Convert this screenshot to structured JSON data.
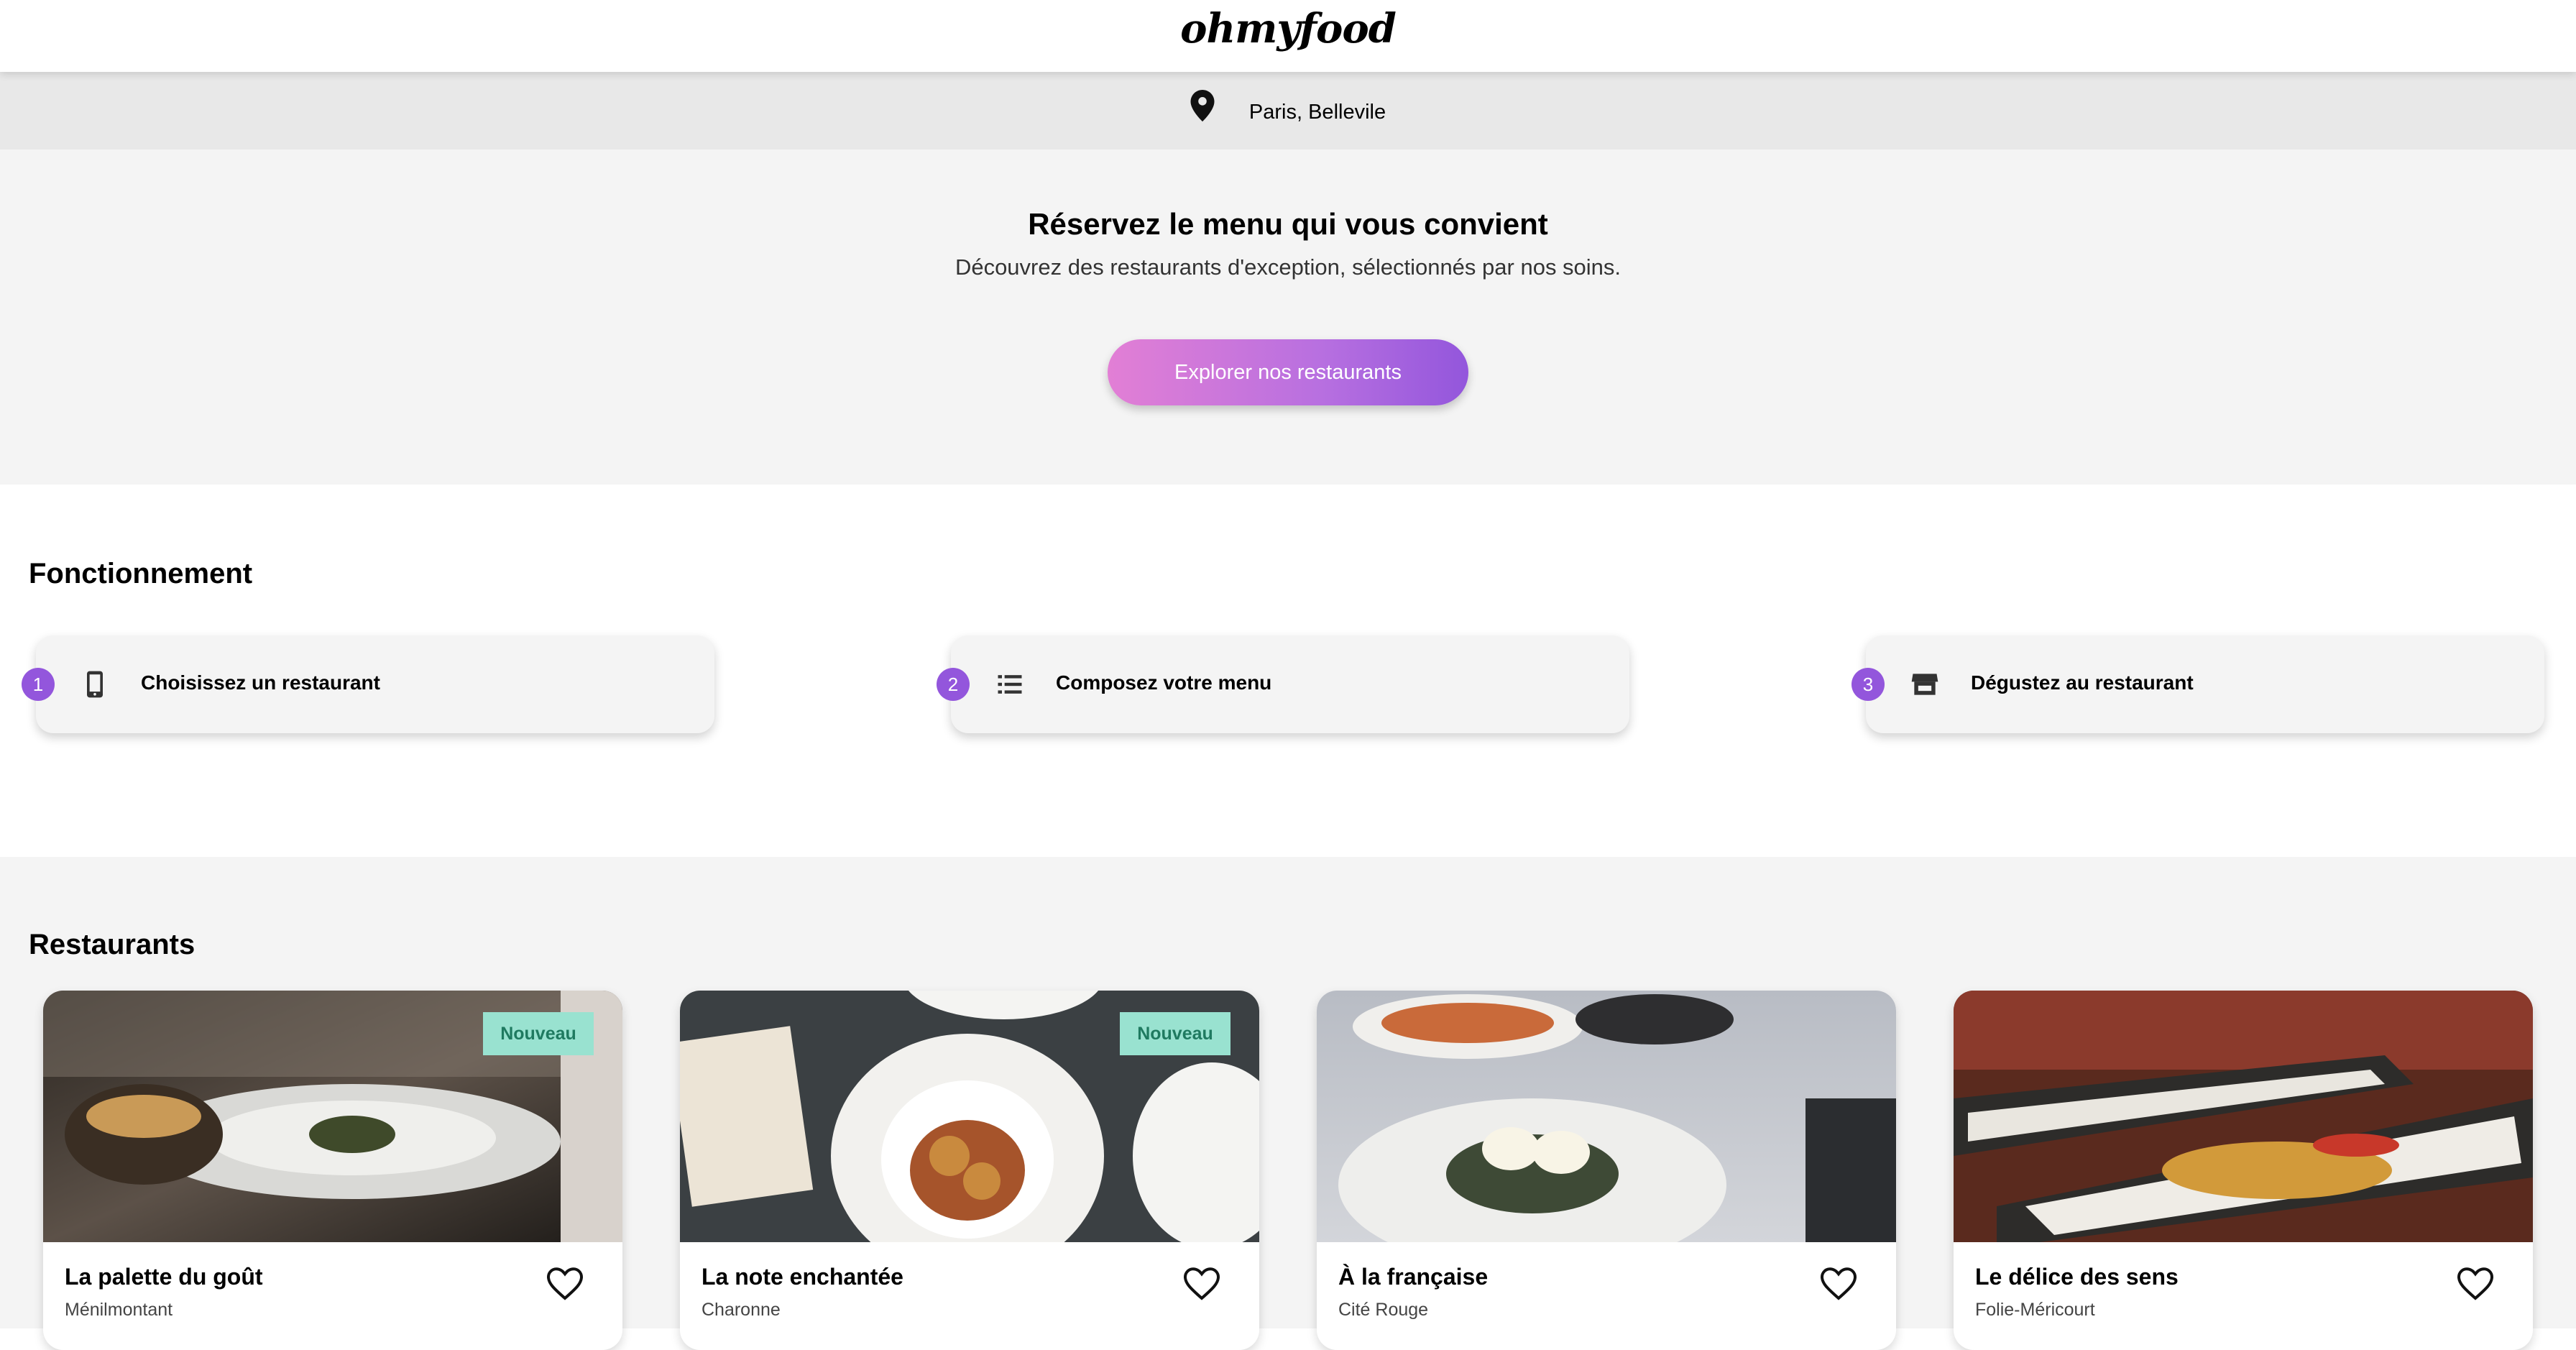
{
  "header": {
    "logo": "ohmyfood"
  },
  "location": {
    "icon": "location-pin-icon",
    "text": "Paris, Bellevile"
  },
  "hero": {
    "title": "Réservez le menu qui vous convient",
    "subtitle": "Découvrez des restaurants d'exception, sélectionnés par nos soins.",
    "button": "Explorer nos restaurants"
  },
  "how": {
    "title": "Fonctionnement",
    "steps": [
      {
        "num": "1",
        "icon": "smartphone-icon",
        "label": "Choisissez un restaurant"
      },
      {
        "num": "2",
        "icon": "list-icon",
        "label": "Composez votre menu"
      },
      {
        "num": "3",
        "icon": "store-icon",
        "label": "Dégustez au restaurant"
      }
    ]
  },
  "restaurants": {
    "title": "Restaurants",
    "items": [
      {
        "name": "La palette du goût",
        "area": "Ménilmontant",
        "badge": "Nouveau"
      },
      {
        "name": "La note enchantée",
        "area": "Charonne",
        "badge": "Nouveau"
      },
      {
        "name": "À la française",
        "area": "Cité Rouge"
      },
      {
        "name": "Le délice des sens",
        "area": "Folie-Méricourt"
      }
    ]
  },
  "colors": {
    "accent": "#9356dc",
    "gradient_start": "#e27fd5",
    "badge_bg": "#99e2d0",
    "badge_text": "#1f7a60"
  }
}
